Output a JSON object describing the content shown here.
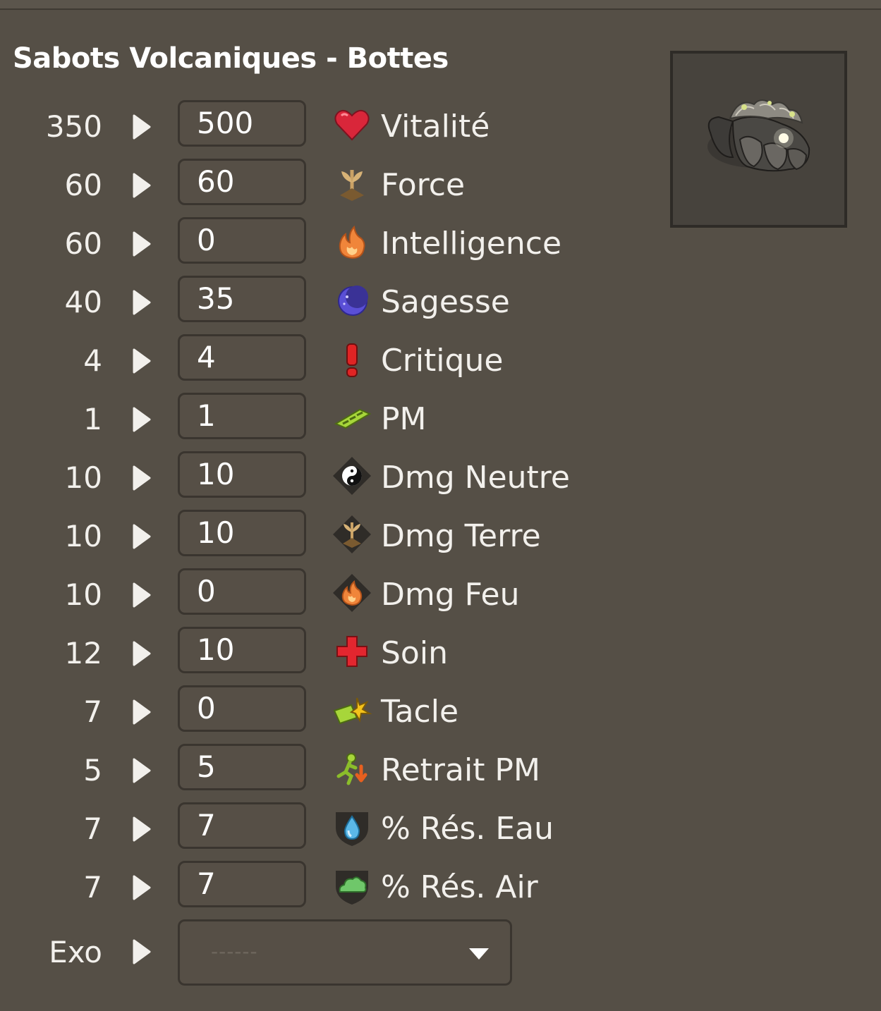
{
  "item": {
    "title": "Sabots Volcaniques - Bottes",
    "image_icon": "boots-item-icon"
  },
  "stats": [
    {
      "base": "350",
      "value": "500",
      "label": "Vitalité",
      "icon": "heart-icon"
    },
    {
      "base": "60",
      "value": "60",
      "label": "Force",
      "icon": "earth-plant-icon"
    },
    {
      "base": "60",
      "value": "0",
      "label": "Intelligence",
      "icon": "fire-icon"
    },
    {
      "base": "40",
      "value": "35",
      "label": "Sagesse",
      "icon": "moon-icon"
    },
    {
      "base": "4",
      "value": "4",
      "label": "Critique",
      "icon": "exclamation-icon"
    },
    {
      "base": "1",
      "value": "1",
      "label": "PM",
      "icon": "movement-points-icon"
    },
    {
      "base": "10",
      "value": "10",
      "label": "Dmg Neutre",
      "icon": "neutral-yinyang-icon"
    },
    {
      "base": "10",
      "value": "10",
      "label": "Dmg Terre",
      "icon": "earth-damage-icon"
    },
    {
      "base": "10",
      "value": "0",
      "label": "Dmg Feu",
      "icon": "fire-damage-icon"
    },
    {
      "base": "12",
      "value": "10",
      "label": "Soin",
      "icon": "heal-cross-icon"
    },
    {
      "base": "7",
      "value": "0",
      "label": "Tacle",
      "icon": "tackle-icon"
    },
    {
      "base": "5",
      "value": "5",
      "label": "Retrait PM",
      "icon": "mp-reduction-icon"
    },
    {
      "base": "7",
      "value": "7",
      "label": "% Rés. Eau",
      "icon": "water-resistance-icon"
    },
    {
      "base": "7",
      "value": "7",
      "label": "% Rés. Air",
      "icon": "air-resistance-icon"
    }
  ],
  "exo": {
    "label": "Exo",
    "selected": "------",
    "dropdown_icon": "chevron-down-icon"
  },
  "colors": {
    "background": "#554f46",
    "text": "#f2f0ec"
  }
}
